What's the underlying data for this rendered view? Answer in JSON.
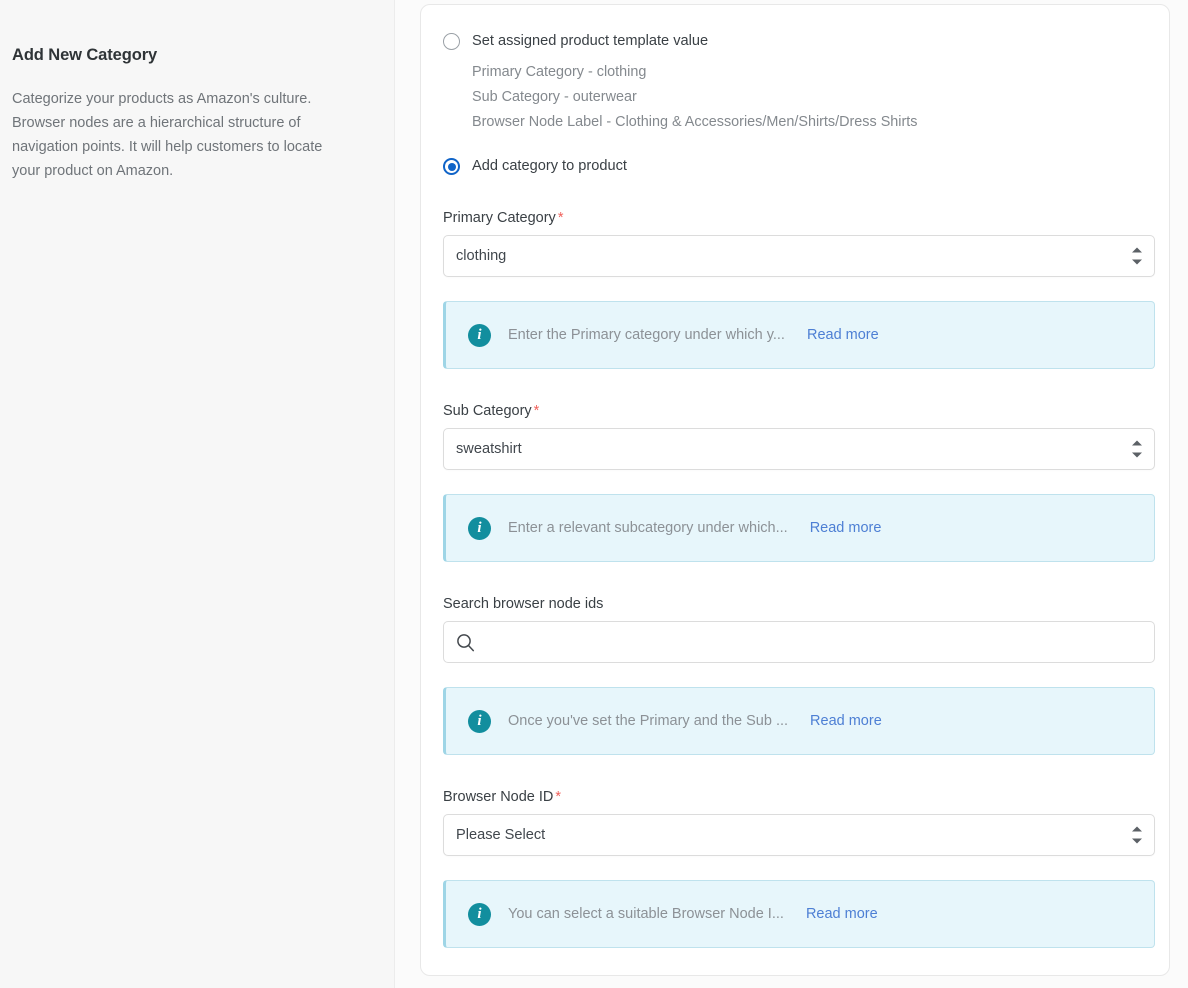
{
  "left_panel": {
    "title": "Add New Category",
    "description": "Categorize your products as Amazon's culture. Browser nodes are a hierarchical structure of navigation points. It will help customers to locate your product on Amazon."
  },
  "form": {
    "radio_options": [
      {
        "label": "Set assigned product template value",
        "selected": false,
        "sublines": [
          "Primary Category - clothing",
          "Sub Category - outerwear",
          "Browser Node Label - Clothing & Accessories/Men/Shirts/Dress Shirts"
        ]
      },
      {
        "label": "Add category to product",
        "selected": true,
        "sublines": []
      }
    ],
    "fields": [
      {
        "label": "Primary Category",
        "required_star": "*",
        "value": "clothing",
        "info_text": "Enter the Primary category under which y...",
        "info_link": "Read more",
        "icon": "info-icon"
      },
      {
        "label": "Sub Category",
        "required_star": "*",
        "value": "sweatshirt",
        "info_text": "Enter a relevant subcategory under which...",
        "info_link": "Read more",
        "icon": "info-icon"
      },
      {
        "label": "Search browser node ids",
        "required_star": "",
        "value": "",
        "placeholder": "",
        "info_text": "Once you've set the Primary and the Sub ...",
        "info_link": "Read more",
        "icon": "search-icon"
      },
      {
        "label": "Browser Node ID",
        "required_star": "*",
        "value": "Please Select",
        "info_text": "You can select a suitable Browser Node I...",
        "info_link": "Read more",
        "icon": "info-icon"
      }
    ]
  },
  "colors": {
    "radio_selected": "#1064c8",
    "required_star": "#f0615b",
    "info_background": "#e7f6fb",
    "info_icon": "#128e9e",
    "info_link": "#4d7fd4",
    "panel_background": "#f7f7f7"
  }
}
